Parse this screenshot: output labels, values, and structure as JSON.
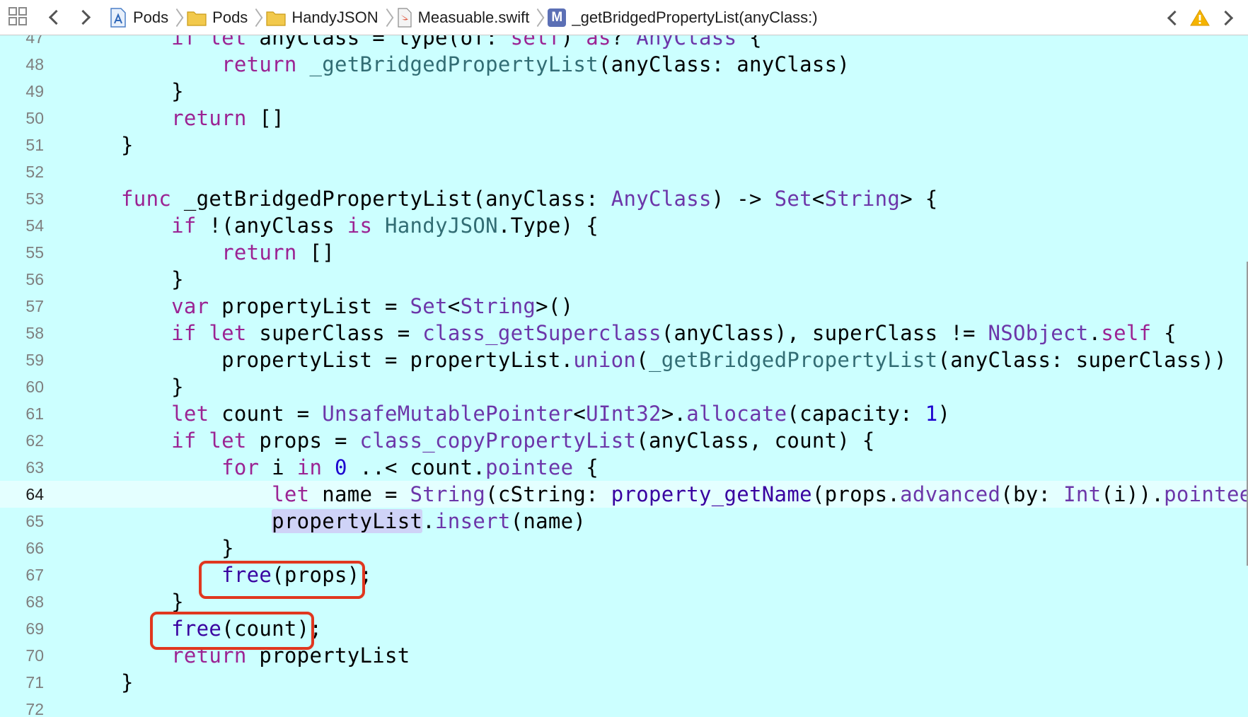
{
  "breadcrumb": {
    "items": [
      {
        "label": "Pods",
        "icon": "project-icon"
      },
      {
        "label": "Pods",
        "icon": "folder-icon"
      },
      {
        "label": "HandyJSON",
        "icon": "folder-icon"
      },
      {
        "label": "Measuable.swift",
        "icon": "swift-file-icon"
      },
      {
        "label": "_getBridgedPropertyList(anyClass:)",
        "icon": "method-icon",
        "badge": "M"
      }
    ]
  },
  "colors": {
    "editor_background": "#ccffff",
    "keyword": "#9b2393",
    "type": "#6c36a9",
    "number": "#1c00cf",
    "annotation_box": "#e0371f",
    "warning": "#f5b400"
  },
  "editor": {
    "current_line": "64",
    "lines": [
      {
        "no": "47",
        "tokens": [
          {
            "t": "        "
          },
          {
            "t": "if",
            "c": "kw"
          },
          {
            "t": " "
          },
          {
            "t": "let",
            "c": "kw"
          },
          {
            "t": " anyClass = type(of: "
          },
          {
            "t": "self",
            "c": "kw"
          },
          {
            "t": ") "
          },
          {
            "t": "as",
            "c": "kw"
          },
          {
            "t": "? "
          },
          {
            "t": "AnyClass",
            "c": "ty"
          },
          {
            "t": " {"
          }
        ]
      },
      {
        "no": "48",
        "tokens": [
          {
            "t": "            "
          },
          {
            "t": "return",
            "c": "kw"
          },
          {
            "t": " "
          },
          {
            "t": "_getBridgedPropertyList",
            "c": "fn"
          },
          {
            "t": "(anyClass: anyClass)"
          }
        ]
      },
      {
        "no": "49",
        "tokens": [
          {
            "t": "        }"
          }
        ]
      },
      {
        "no": "50",
        "tokens": [
          {
            "t": "        "
          },
          {
            "t": "return",
            "c": "kw"
          },
          {
            "t": " []"
          }
        ]
      },
      {
        "no": "51",
        "tokens": [
          {
            "t": "    }"
          }
        ]
      },
      {
        "no": "52",
        "tokens": []
      },
      {
        "no": "53",
        "tokens": [
          {
            "t": "    "
          },
          {
            "t": "func",
            "c": "kw"
          },
          {
            "t": " _getBridgedPropertyList(anyClass: "
          },
          {
            "t": "AnyClass",
            "c": "ty"
          },
          {
            "t": ") -> "
          },
          {
            "t": "Set",
            "c": "ty"
          },
          {
            "t": "<"
          },
          {
            "t": "String",
            "c": "ty"
          },
          {
            "t": "> {"
          }
        ]
      },
      {
        "no": "54",
        "tokens": [
          {
            "t": "        "
          },
          {
            "t": "if",
            "c": "kw"
          },
          {
            "t": " !(anyClass "
          },
          {
            "t": "is",
            "c": "kw"
          },
          {
            "t": " "
          },
          {
            "t": "HandyJSON",
            "c": "fn"
          },
          {
            "t": ".Type) {"
          }
        ]
      },
      {
        "no": "55",
        "tokens": [
          {
            "t": "            "
          },
          {
            "t": "return",
            "c": "kw"
          },
          {
            "t": " []"
          }
        ]
      },
      {
        "no": "56",
        "tokens": [
          {
            "t": "        }"
          }
        ]
      },
      {
        "no": "57",
        "tokens": [
          {
            "t": "        "
          },
          {
            "t": "var",
            "c": "kw"
          },
          {
            "t": " propertyList = "
          },
          {
            "t": "Set",
            "c": "ty"
          },
          {
            "t": "<"
          },
          {
            "t": "String",
            "c": "ty"
          },
          {
            "t": ">()"
          }
        ]
      },
      {
        "no": "58",
        "tokens": [
          {
            "t": "        "
          },
          {
            "t": "if",
            "c": "kw"
          },
          {
            "t": " "
          },
          {
            "t": "let",
            "c": "kw"
          },
          {
            "t": " superClass = "
          },
          {
            "t": "class_getSuperclass",
            "c": "ty"
          },
          {
            "t": "(anyClass), superClass != "
          },
          {
            "t": "NSObject",
            "c": "ty"
          },
          {
            "t": "."
          },
          {
            "t": "self",
            "c": "kw"
          },
          {
            "t": " {"
          }
        ]
      },
      {
        "no": "59",
        "tokens": [
          {
            "t": "            propertyList = propertyList."
          },
          {
            "t": "union",
            "c": "ty"
          },
          {
            "t": "("
          },
          {
            "t": "_getBridgedPropertyList",
            "c": "fn"
          },
          {
            "t": "(anyClass: superClass))"
          }
        ]
      },
      {
        "no": "60",
        "tokens": [
          {
            "t": "        }"
          }
        ]
      },
      {
        "no": "61",
        "tokens": [
          {
            "t": "        "
          },
          {
            "t": "let",
            "c": "kw"
          },
          {
            "t": " count = "
          },
          {
            "t": "UnsafeMutablePointer",
            "c": "ty"
          },
          {
            "t": "<"
          },
          {
            "t": "UInt32",
            "c": "ty"
          },
          {
            "t": ">."
          },
          {
            "t": "allocate",
            "c": "ty"
          },
          {
            "t": "(capacity: "
          },
          {
            "t": "1",
            "c": "num"
          },
          {
            "t": ")"
          }
        ]
      },
      {
        "no": "62",
        "tokens": [
          {
            "t": "        "
          },
          {
            "t": "if",
            "c": "kw"
          },
          {
            "t": " "
          },
          {
            "t": "let",
            "c": "kw"
          },
          {
            "t": " props = "
          },
          {
            "t": "class_copyPropertyList",
            "c": "ty"
          },
          {
            "t": "(anyClass, count) {"
          }
        ]
      },
      {
        "no": "63",
        "tokens": [
          {
            "t": "            "
          },
          {
            "t": "for",
            "c": "kw"
          },
          {
            "t": " i "
          },
          {
            "t": "in",
            "c": "kw"
          },
          {
            "t": " "
          },
          {
            "t": "0",
            "c": "num"
          },
          {
            "t": " ..< count."
          },
          {
            "t": "pointee",
            "c": "ty"
          },
          {
            "t": " {"
          }
        ]
      },
      {
        "no": "64",
        "tokens": [
          {
            "t": "                "
          },
          {
            "t": "let",
            "c": "kw"
          },
          {
            "t": " name = "
          },
          {
            "t": "String",
            "c": "ty"
          },
          {
            "t": "(cString: "
          },
          {
            "t": "property_getName",
            "c": "fn2"
          },
          {
            "t": "(props."
          },
          {
            "t": "advanced",
            "c": "ty"
          },
          {
            "t": "(by: "
          },
          {
            "t": "Int",
            "c": "ty"
          },
          {
            "t": "(i))."
          },
          {
            "t": "pointee",
            "c": "ty"
          },
          {
            "t": "))"
          }
        ]
      },
      {
        "no": "65",
        "tokens": [
          {
            "t": "                "
          },
          {
            "t": "propertyList",
            "c": "sel"
          },
          {
            "t": "."
          },
          {
            "t": "insert",
            "c": "ty"
          },
          {
            "t": "(name)"
          }
        ]
      },
      {
        "no": "66",
        "tokens": [
          {
            "t": "            }"
          }
        ]
      },
      {
        "no": "67",
        "tokens": [
          {
            "t": "            "
          },
          {
            "t": "free",
            "c": "fn2"
          },
          {
            "t": "(props);"
          }
        ]
      },
      {
        "no": "68",
        "tokens": [
          {
            "t": "        }"
          }
        ]
      },
      {
        "no": "69",
        "tokens": [
          {
            "t": "        "
          },
          {
            "t": "free",
            "c": "fn2"
          },
          {
            "t": "(count);"
          }
        ]
      },
      {
        "no": "70",
        "tokens": [
          {
            "t": "        "
          },
          {
            "t": "return",
            "c": "kw"
          },
          {
            "t": " propertyList"
          }
        ]
      },
      {
        "no": "71",
        "tokens": [
          {
            "t": "    }"
          }
        ]
      },
      {
        "no": "72",
        "tokens": []
      }
    ]
  }
}
